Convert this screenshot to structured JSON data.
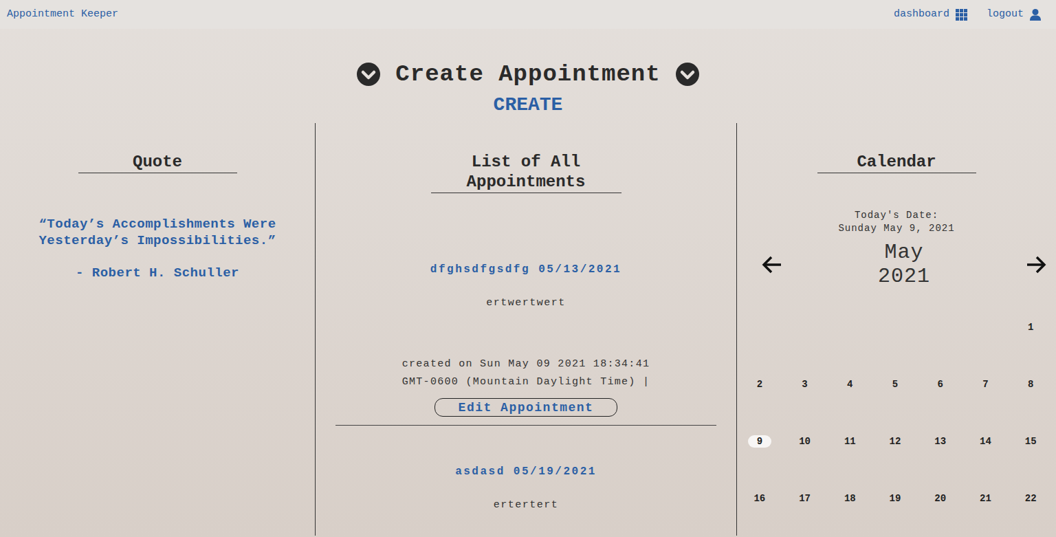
{
  "brand": "Appointment Keeper",
  "nav": [
    {
      "label": "dashboard"
    },
    {
      "label": "logout"
    }
  ],
  "heading": "Create Appointment",
  "create_link": "CREATE",
  "quote": {
    "title": "Quote",
    "text": "“Today’s Accomplishments Were Yesterday’s Impossibilities.”",
    "author": "- Robert H. Schuller"
  },
  "appointments": {
    "title": "List of All Appointments",
    "items": [
      {
        "title": "dfghsdfgsdfg 05/13/2021",
        "description": "ertwertwert",
        "created": "created on Sun May 09 2021 18:34:41 GMT-0600 (Mountain Daylight Time) |",
        "button": "Edit Appointment"
      },
      {
        "title": "asdasd 05/19/2021",
        "description": "ertertert"
      }
    ]
  },
  "calendar": {
    "title": "Calendar",
    "today_label": "Today's Date:",
    "today": "Sunday May 9, 2021",
    "month": "May",
    "year": "2021",
    "weeks": [
      [
        null,
        null,
        null,
        null,
        null,
        null,
        {
          "day": "1",
          "selected": false
        }
      ],
      [
        {
          "day": "2",
          "selected": false
        },
        {
          "day": "3",
          "selected": false
        },
        {
          "day": "4",
          "selected": false
        },
        {
          "day": "5",
          "selected": false
        },
        {
          "day": "6",
          "selected": false
        },
        {
          "day": "7",
          "selected": false
        },
        {
          "day": "8",
          "selected": false
        }
      ],
      [
        {
          "day": "9",
          "selected": true
        },
        {
          "day": "10",
          "selected": false
        },
        {
          "day": "11",
          "selected": false
        },
        {
          "day": "12",
          "selected": false
        },
        {
          "day": "13",
          "selected": false
        },
        {
          "day": "14",
          "selected": false
        },
        {
          "day": "15",
          "selected": false
        }
      ],
      [
        {
          "day": "16",
          "selected": false
        },
        {
          "day": "17",
          "selected": false
        },
        {
          "day": "18",
          "selected": false
        },
        {
          "day": "19",
          "selected": false
        },
        {
          "day": "20",
          "selected": false
        },
        {
          "day": "21",
          "selected": false
        },
        {
          "day": "22",
          "selected": false
        }
      ]
    ]
  }
}
